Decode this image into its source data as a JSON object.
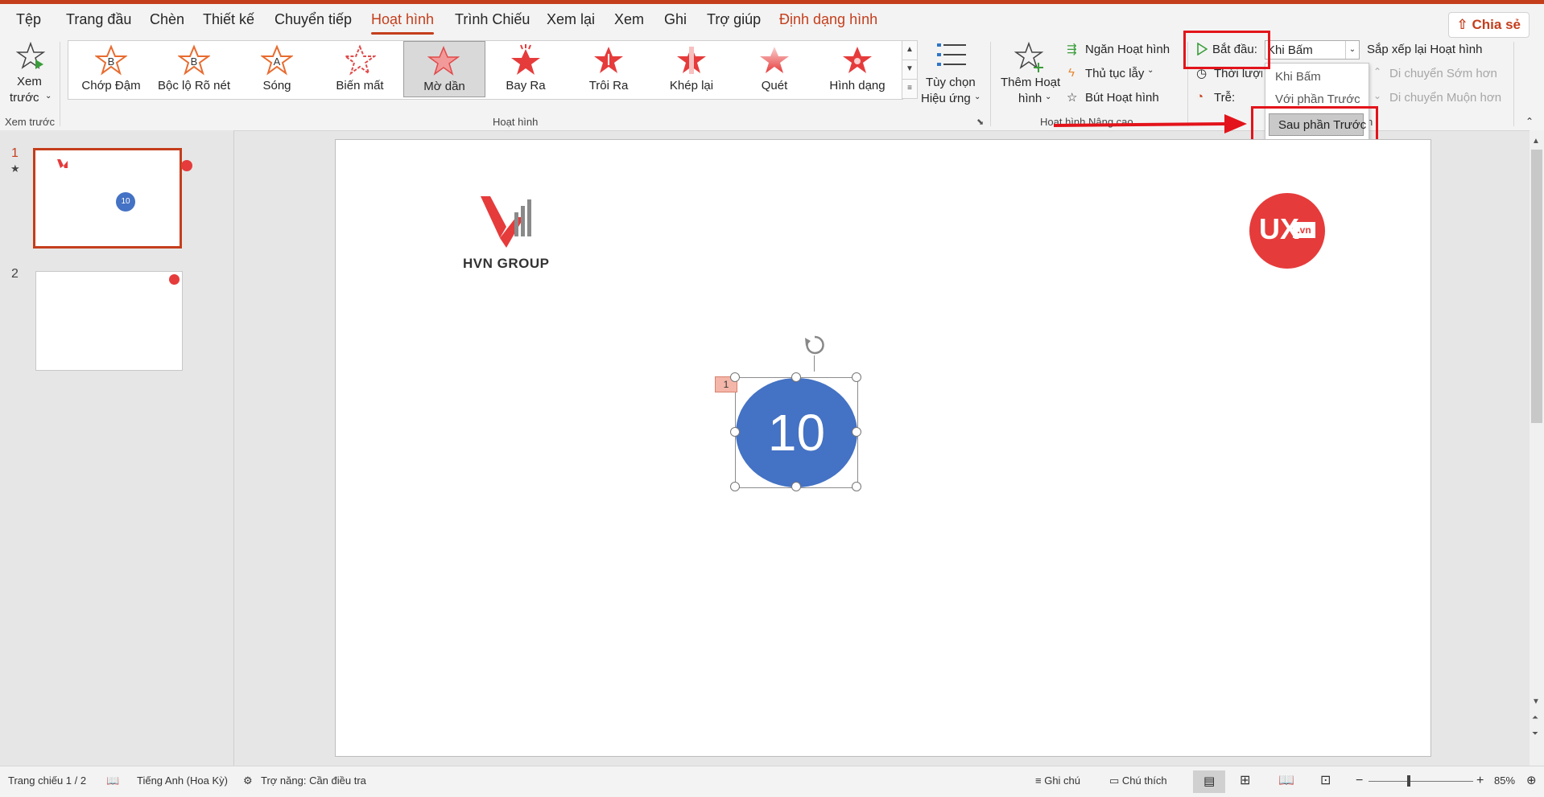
{
  "tabs": [
    {
      "label": "Tệp",
      "active": false
    },
    {
      "label": "Trang đầu",
      "active": false
    },
    {
      "label": "Chèn",
      "active": false
    },
    {
      "label": "Thiết kế",
      "active": false
    },
    {
      "label": "Chuyển tiếp",
      "active": false
    },
    {
      "label": "Hoạt hình",
      "active": true
    },
    {
      "label": "Trình Chiếu",
      "active": false
    },
    {
      "label": "Xem lại",
      "active": false
    },
    {
      "label": "Xem",
      "active": false
    },
    {
      "label": "Ghi",
      "active": false
    },
    {
      "label": "Trợ giúp",
      "active": false
    },
    {
      "label": "Định dạng hình",
      "active": false
    }
  ],
  "share_label": "Chia sẻ",
  "preview": {
    "label_line1": "Xem",
    "label_line2": "trước",
    "group": "Xem trước"
  },
  "animations": {
    "group": "Hoạt hình",
    "items": [
      {
        "label": "Chớp Đậm",
        "letter": "B"
      },
      {
        "label": "Bộc lộ Rõ nét",
        "letter": "B"
      },
      {
        "label": "Sóng",
        "letter": "A"
      },
      {
        "label": "Biến mất",
        "letter": ""
      },
      {
        "label": "Mờ dần",
        "letter": "",
        "selected": true
      },
      {
        "label": "Bay Ra",
        "letter": ""
      },
      {
        "label": "Trôi Ra",
        "letter": ""
      },
      {
        "label": "Khép lại",
        "letter": ""
      },
      {
        "label": "Quét",
        "letter": ""
      },
      {
        "label": "Hình dạng",
        "letter": ""
      }
    ],
    "effect_options_line1": "Tùy chọn",
    "effect_options_line2": "Hiệu ứng"
  },
  "advanced": {
    "group": "Hoạt hình Nâng cao",
    "add_line1": "Thêm Hoạt",
    "add_line2": "hình",
    "pane": "Ngăn Hoạt hình",
    "trigger": "Thủ tục lẫy",
    "painter": "Bút Hoạt hình"
  },
  "timing": {
    "start_label": "Bắt đầu:",
    "start_value": "Khi Bấm",
    "duration_label": "Thời lượng",
    "delay_label": "Trễ:",
    "reorder_title": "Sắp xếp lại Hoạt hình",
    "move_earlier": "Di chuyển Sớm hơn",
    "move_later": "Di chuyển Muộn hơn",
    "group_tail": "n"
  },
  "dropdown": {
    "options": [
      "Khi Bấm",
      "Với phần Trước",
      "Sau phần Trước"
    ],
    "highlighted": "Sau phần Trước"
  },
  "slides": [
    {
      "number": "1",
      "has_animation_star": true,
      "circle_text": "10"
    },
    {
      "number": "2"
    }
  ],
  "slide": {
    "logo_left_text": "HVN GROUP",
    "logo_right_text": "UX",
    "logo_right_sub": ".vn",
    "circle_text": "10",
    "anim_tag": "1",
    "circle_color": "#4472c4",
    "accent": "#c43e1c",
    "highlight": "#e3141b"
  },
  "status": {
    "slide_pos": "Trang chiếu 1 / 2",
    "language": "Tiếng Anh (Hoa Kỳ)",
    "accessibility": "Trợ năng: Cần điều tra",
    "notes": "Ghi chú",
    "comments": "Chú thích",
    "zoom": "85%"
  }
}
